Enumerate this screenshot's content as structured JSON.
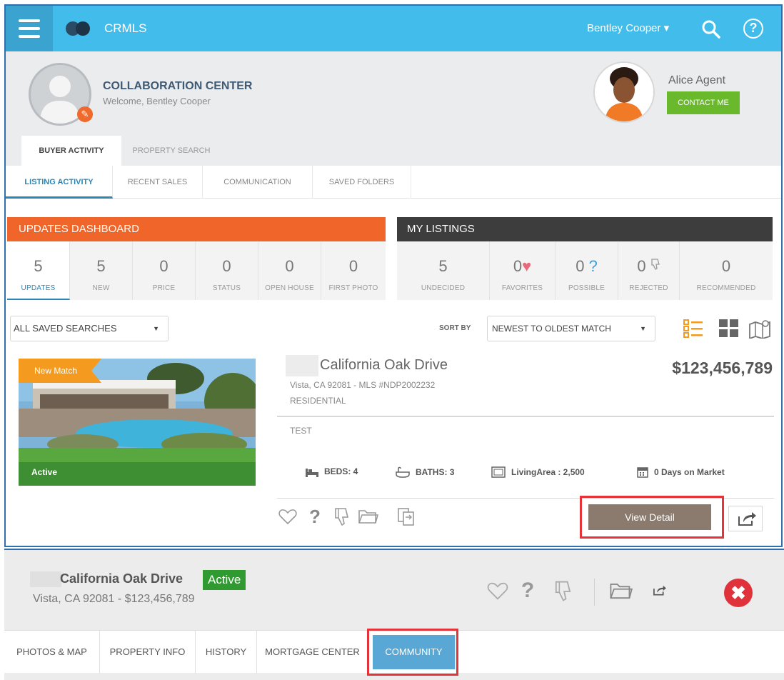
{
  "topbar": {
    "app_title": "CRMLS",
    "user_name": "Bentley Cooper ▾",
    "help_symbol": "?",
    "colors": {
      "bar": "#42bdeb",
      "menu": "#3aa3cf"
    },
    "icons": [
      "menu-icon",
      "crmls-logo",
      "search-icon",
      "help-icon"
    ]
  },
  "header": {
    "title": "COLLABORATION CENTER",
    "welcome": "Welcome, Bentley Cooper",
    "agent_name": "Alice Agent",
    "contact_label": "CONTACT ME",
    "tabs": [
      "BUYER ACTIVITY",
      "PROPERTY SEARCH"
    ]
  },
  "subtabs": [
    "LISTING ACTIVITY",
    "RECENT SALES",
    "COMMUNICATION",
    "SAVED FOLDERS"
  ],
  "updates": {
    "title": "UPDATES DASHBOARD",
    "stats": [
      {
        "num": "5",
        "label": "UPDATES"
      },
      {
        "num": "5",
        "label": "NEW"
      },
      {
        "num": "0",
        "label": "PRICE"
      },
      {
        "num": "0",
        "label": "STATUS"
      },
      {
        "num": "0",
        "label": "OPEN HOUSE"
      },
      {
        "num": "0",
        "label": "FIRST PHOTO"
      }
    ]
  },
  "my_listings": {
    "title": "MY LISTINGS",
    "stats": [
      {
        "num": "5",
        "label": "UNDECIDED",
        "icon": ""
      },
      {
        "num": "0",
        "label": "FAVORITES",
        "icon": "♥"
      },
      {
        "num": "0",
        "label": "POSSIBLE",
        "icon": "?"
      },
      {
        "num": "0",
        "label": "REJECTED",
        "icon": "thumbs-down-icon"
      },
      {
        "num": "0",
        "label": "RECOMMENDED",
        "icon": ""
      }
    ]
  },
  "filters": {
    "saved_searches": "ALL SAVED SEARCHES",
    "sort_label": "SORT BY",
    "sort_value": "NEWEST TO OLDEST MATCH",
    "caret": "▼"
  },
  "listing": {
    "badge": "New Match",
    "photo_status": "Active",
    "address": "California Oak Drive",
    "price": "$123,456,789",
    "city_mls": "Vista, CA 92081 - MLS #NDP2002232",
    "type": "RESIDENTIAL",
    "remarks": "TEST",
    "beds": "BEDS: 4",
    "baths": "BATHS: 3",
    "living_area": "LivingArea : 2,500",
    "days_on_market": "0 Days on Market",
    "view_detail": "View Detail",
    "action_qmark": "?"
  },
  "detail": {
    "address": "California Oak Drive",
    "status": "Active",
    "city_price": "Vista, CA 92081 - $123,456,789",
    "qmark": "?",
    "close_symbol": "✖",
    "tabs": [
      "PHOTOS & MAP",
      "PROPERTY INFO",
      "HISTORY",
      "MORTGAGE CENTER",
      "COMMUNITY"
    ]
  }
}
